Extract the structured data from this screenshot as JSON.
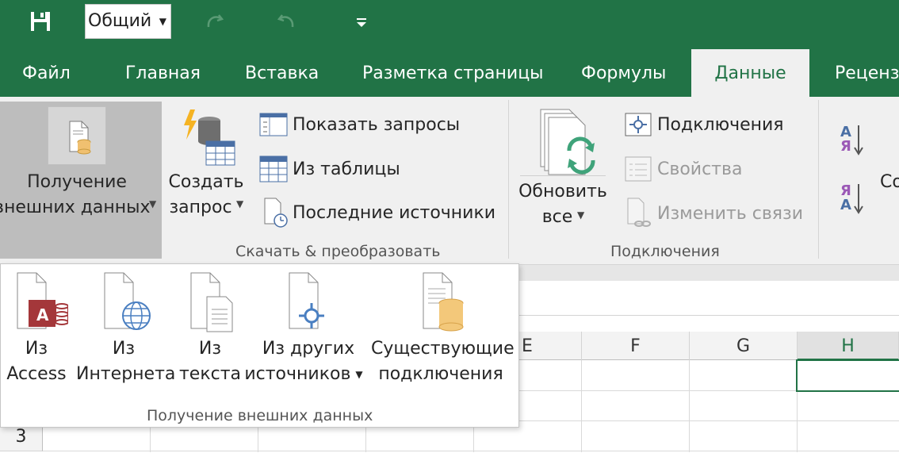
{
  "quick_access": {
    "number_format": "Общий",
    "icons": [
      "save-icon",
      "redo-icon",
      "undo-icon",
      "customize-qat-icon"
    ]
  },
  "tabs": [
    {
      "label": "Файл"
    },
    {
      "label": "Главная"
    },
    {
      "label": "Вставка"
    },
    {
      "label": "Разметка страницы"
    },
    {
      "label": "Формулы"
    },
    {
      "label": "Данные"
    },
    {
      "label": "Рецензи"
    }
  ],
  "active_tab": "Данные",
  "ribbon": {
    "get_external": {
      "line1": "Получение",
      "line2": "внешних данных"
    },
    "create_query": {
      "line1": "Создать",
      "line2": "запрос"
    },
    "show_queries": "Показать запросы",
    "from_table": "Из таблицы",
    "recent_sources": "Последние источники",
    "group_transform": "Скачать & преобразовать",
    "refresh_all": {
      "line1": "Обновить",
      "line2": "все"
    },
    "connections": "Подключения",
    "properties": "Свойства",
    "edit_links": "Изменить связи",
    "group_connections": "Подключения",
    "sort_az": {
      "top": "А",
      "bottom": "Я"
    },
    "sort_za": {
      "top": "Я",
      "bottom": "А"
    },
    "sort_cut": "Со"
  },
  "dropdown": {
    "from_access": {
      "line1": "Из",
      "line2": "Access"
    },
    "from_web": {
      "line1": "Из",
      "line2": "Интернета"
    },
    "from_text": {
      "line1": "Из",
      "line2": "текста"
    },
    "from_other": {
      "line1": "Из других",
      "line2": "источников"
    },
    "existing": {
      "line1": "Существующие",
      "line2": "подключения"
    },
    "group_label": "Получение внешних данных"
  },
  "grid": {
    "columns": [
      "E",
      "F",
      "G",
      "H"
    ],
    "selected_column": "H",
    "visible_row": "3"
  },
  "colors": {
    "brand": "#217346",
    "ribbon_bg": "#f0f0f0",
    "pressed_bg": "#bdbdbd"
  }
}
